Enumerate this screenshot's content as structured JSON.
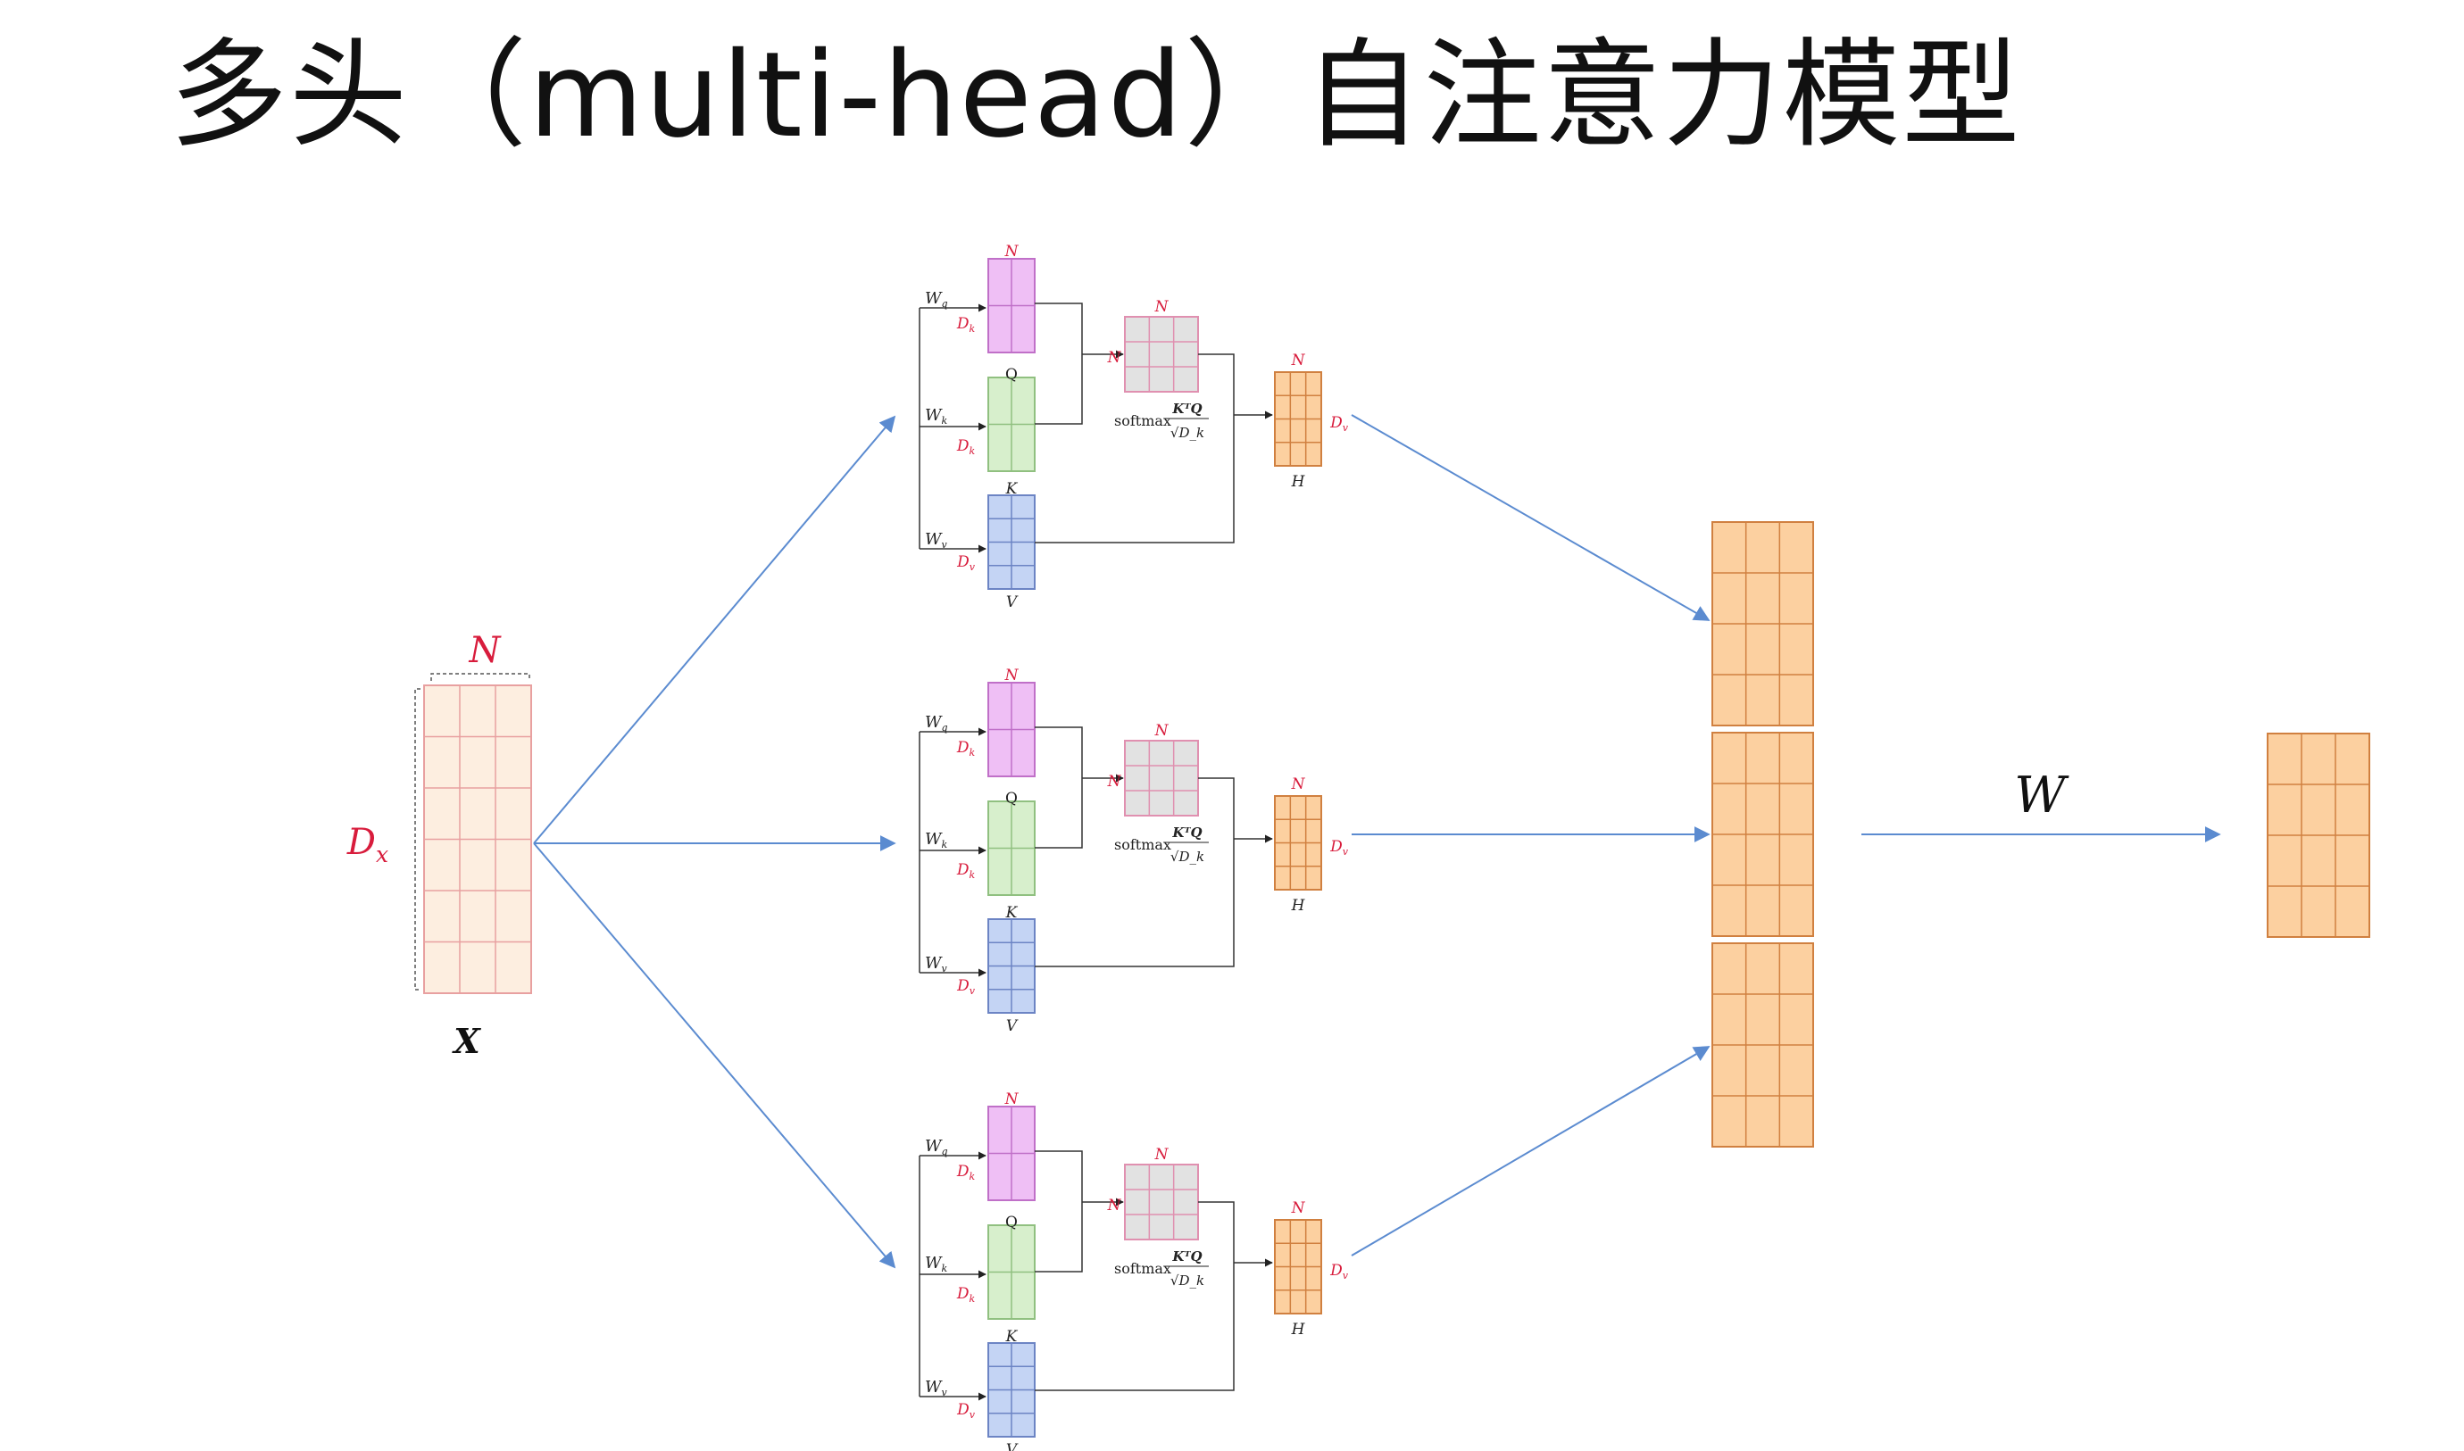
{
  "title": "多头（multi-head）自注意力模型",
  "input": {
    "name": "X",
    "width_label": "N",
    "height_label": "D_x"
  },
  "heads": [
    {
      "q_label": "Q",
      "k_label": "K",
      "v_label": "V",
      "wq": "W_q",
      "wk": "W_k",
      "wv": "W_v",
      "dk": "D_k",
      "dv": "D_v",
      "n": "N",
      "softmax": "softmax",
      "softmax_num": "KᵀQ",
      "softmax_den": "√D_k",
      "output_label": "H"
    },
    {
      "q_label": "Q",
      "k_label": "K",
      "v_label": "V",
      "wq": "W_q",
      "wk": "W_k",
      "wv": "W_v",
      "dk": "D_k",
      "dv": "D_v",
      "n": "N",
      "softmax": "softmax",
      "softmax_num": "KᵀQ",
      "softmax_den": "√D_k",
      "output_label": "H"
    },
    {
      "q_label": "Q",
      "k_label": "K",
      "v_label": "V",
      "wq": "W_q",
      "wk": "W_k",
      "wv": "W_v",
      "dk": "D_k",
      "dv": "D_v",
      "n": "N",
      "softmax": "softmax",
      "softmax_num": "KᵀQ",
      "softmax_den": "√D_k",
      "output_label": "H"
    }
  ],
  "projection_label": "W",
  "colors": {
    "input_fill": "#fdeee0",
    "input_grid": "#e8a0a0",
    "q_fill": "#efbff5",
    "q_grid": "#c070c8",
    "k_fill": "#d7efcc",
    "k_grid": "#90c080",
    "v_fill": "#c4d4f4",
    "v_grid": "#6c84c4",
    "score_fill": "#e2e2e2",
    "score_grid": "#e090b0",
    "out_fill": "#fcd0a0",
    "out_grid": "#d08040",
    "arrow": "#5b8bd0",
    "red_label": "#d81c3c"
  }
}
